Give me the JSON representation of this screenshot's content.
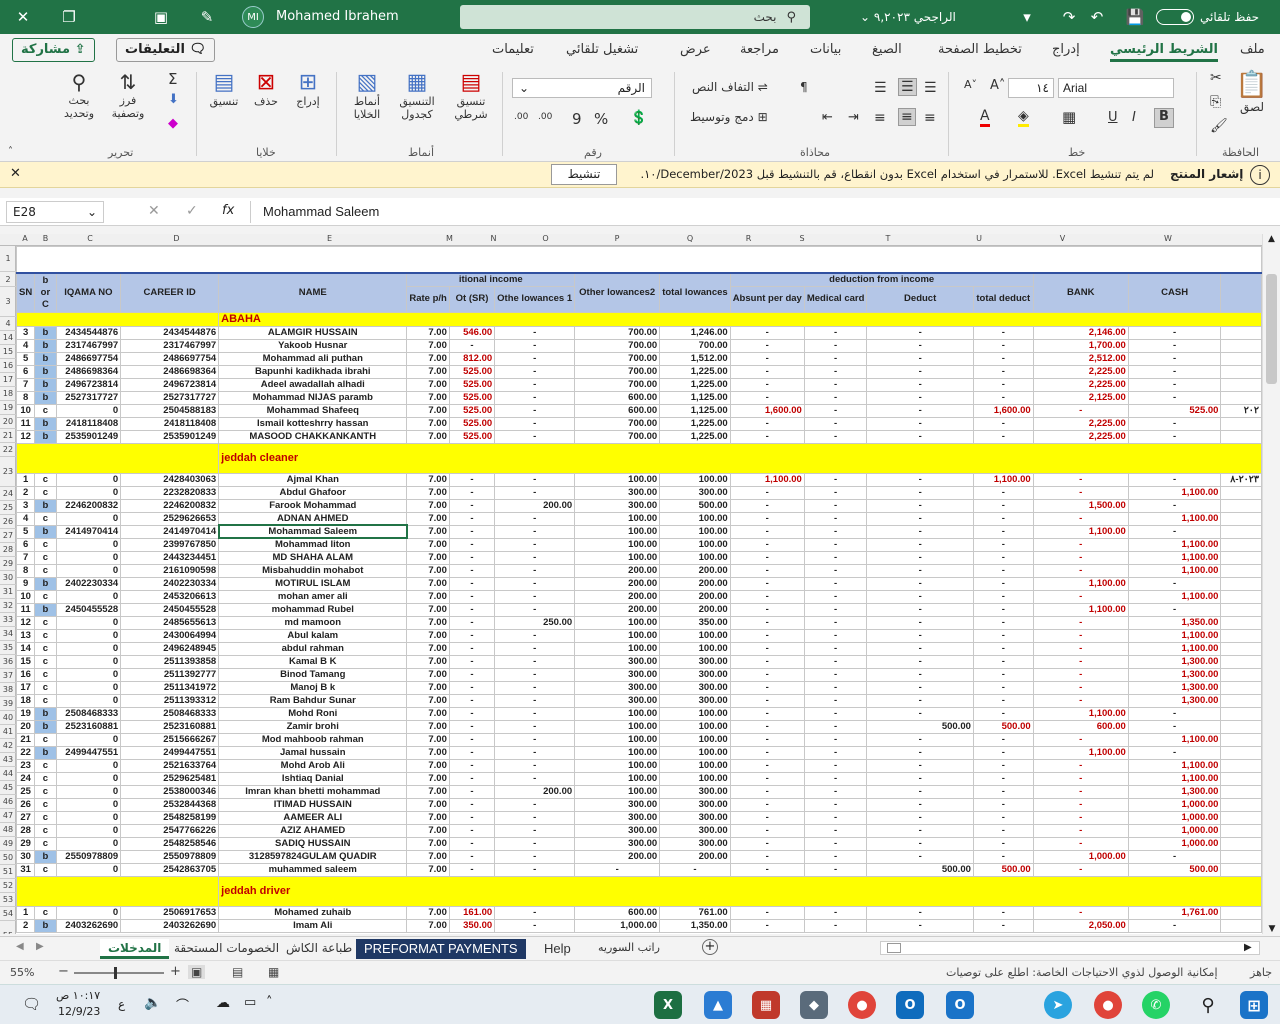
{
  "titlebar": {
    "user_initials": "MI",
    "user": "Mohamed Ibrahem",
    "search": "بحث",
    "file": "الراجحي ٩,٢٠٢٣",
    "autosave": "حفظ تلقائي"
  },
  "tabs": [
    "ملف",
    "الشريط الرئيسي",
    "إدراج",
    "تخطيط الصفحة",
    "الصيغ",
    "بيانات",
    "مراجعة",
    "عرض",
    "تشغيل تلقائي",
    "تعليمات"
  ],
  "share": "مشاركة",
  "comments": "التعليقات",
  "ribbon": {
    "paste": "لصق",
    "font_name": "Arial",
    "font_size": "١٤",
    "wrap": "التفاف النص",
    "merge": "دمج وتوسيط",
    "number_format": "الرقم",
    "cond": "تنسيق شرطي",
    "astable": "التنسيق كجدول",
    "styles": "أنماط الخلايا",
    "insert": "إدراج",
    "delete": "حذف",
    "format": "تنسيق",
    "sort": "فرز وتصفية",
    "find": "بحث وتحديد",
    "g_clip": "الحافظة",
    "g_font": "خط",
    "g_align": "محاذاة",
    "g_num": "رقم",
    "g_styles": "أنماط",
    "g_cells": "خلايا",
    "g_edit": "تحرير"
  },
  "notice": {
    "title": "إشعار المنتج",
    "text": "لم يتم تنشيط Excel. للاستمرار في استخدام Excel بدون انقطاع، قم بالتنشيط قبل December/2023/١٠.",
    "button": "تنشيط"
  },
  "formula": {
    "cellref": "E28",
    "fx": "fx",
    "value": "Mohammad Saleem"
  },
  "columns": [
    "A",
    "B",
    "C",
    "D",
    "E",
    "M",
    "N",
    "O",
    "P",
    "Q",
    "R",
    "S",
    "T",
    "U",
    "V",
    "W"
  ],
  "headers": {
    "sn": "SN",
    "bc": "b or C",
    "iqama": "IQAMA NO",
    "career": "CAREER ID",
    "name": "NAME",
    "addl": "itional income",
    "rate": "Rate p/h",
    "ot": "Ot (SR)",
    "other1": "Othe lowances 1",
    "other2": "Other lowances2",
    "total": "total lowances",
    "deduction": "deduction from income",
    "absent": "Absunt per day",
    "medical": "Medical card",
    "deduct": "Deduct",
    "totdeduct": "total deduct",
    "bank": "BANK",
    "cash": "CASH"
  },
  "sections": [
    {
      "label": "ABAHA",
      "row": "4",
      "rows": [
        [
          "14",
          "3",
          "b",
          "2434544876",
          "2434544876",
          "ALAMGIR HUSSAIN",
          "7.00",
          "546.00",
          "-",
          "700.00",
          "1,246.00",
          "-",
          "-",
          "-",
          "-",
          "2,146.00",
          "-",
          ""
        ],
        [
          "15",
          "4",
          "b",
          "2317467997",
          "2317467997",
          "Yakoob Husnar",
          "7.00",
          "-",
          "-",
          "700.00",
          "700.00",
          "-",
          "-",
          "-",
          "-",
          "1,700.00",
          "-",
          ""
        ],
        [
          "16",
          "5",
          "b",
          "2486697754",
          "2486697754",
          "Mohammad ali puthan",
          "7.00",
          "812.00",
          "-",
          "700.00",
          "1,512.00",
          "-",
          "-",
          "-",
          "-",
          "2,512.00",
          "-",
          ""
        ],
        [
          "17",
          "6",
          "b",
          "2486698364",
          "2486698364",
          "Bapunhi kadikhada ibrahi",
          "7.00",
          "525.00",
          "-",
          "700.00",
          "1,225.00",
          "-",
          "-",
          "-",
          "-",
          "2,225.00",
          "-",
          ""
        ],
        [
          "18",
          "7",
          "b",
          "2496723814",
          "2496723814",
          "Adeel awadallah alhadi",
          "7.00",
          "525.00",
          "-",
          "700.00",
          "1,225.00",
          "-",
          "-",
          "-",
          "-",
          "2,225.00",
          "-",
          ""
        ],
        [
          "19",
          "8",
          "b",
          "2527317727",
          "2527317727",
          "Mohammad NIJAS paramb",
          "7.00",
          "525.00",
          "-",
          "600.00",
          "1,125.00",
          "-",
          "-",
          "-",
          "-",
          "2,125.00",
          "-",
          ""
        ],
        [
          "20",
          "10",
          "c",
          "0",
          "2504588183",
          "Mohammad Shafeeq",
          "7.00",
          "525.00",
          "-",
          "600.00",
          "1,125.00",
          "1,600.00",
          "-",
          "-",
          "1,600.00",
          "-",
          "525.00",
          "٢٠٢"
        ],
        [
          "21",
          "11",
          "b",
          "2418118408",
          "2418118408",
          "Ismail kotteshrry hassan",
          "7.00",
          "525.00",
          "-",
          "700.00",
          "1,225.00",
          "-",
          "-",
          "-",
          "-",
          "2,225.00",
          "-",
          ""
        ],
        [
          "22",
          "12",
          "b",
          "2535901249",
          "2535901249",
          "MASOOD CHAKKANKANTH",
          "7.00",
          "525.00",
          "-",
          "700.00",
          "1,225.00",
          "-",
          "-",
          "-",
          "-",
          "2,225.00",
          "-",
          ""
        ]
      ]
    },
    {
      "label": "jeddah cleaner",
      "row": "23",
      "rows": [
        [
          "24",
          "1",
          "c",
          "0",
          "2428403063",
          "Ajmal Khan",
          "7.00",
          "-",
          "-",
          "100.00",
          "100.00",
          "1,100.00",
          "-",
          "-",
          "1,100.00",
          "-",
          "-",
          "٢٠٢٣-٨"
        ],
        [
          "25",
          "2",
          "c",
          "0",
          "2232820833",
          "Abdul Ghafoor",
          "7.00",
          "-",
          "-",
          "300.00",
          "300.00",
          "-",
          "-",
          "-",
          "-",
          "-",
          "1,100.00",
          ""
        ],
        [
          "26",
          "3",
          "b",
          "2246200832",
          "2246200832",
          "Farook Mohammad",
          "7.00",
          "-",
          "200.00",
          "300.00",
          "500.00",
          "-",
          "-",
          "-",
          "-",
          "1,500.00",
          "-",
          ""
        ],
        [
          "27",
          "4",
          "c",
          "0",
          "2529626653",
          "ADNAN AHMED",
          "7.00",
          "-",
          "-",
          "100.00",
          "100.00",
          "-",
          "-",
          "-",
          "-",
          "-",
          "1,100.00",
          ""
        ],
        [
          "28",
          "5",
          "b",
          "2414970414",
          "2414970414",
          "Mohammad Saleem",
          "7.00",
          "-",
          "-",
          "100.00",
          "100.00",
          "-",
          "-",
          "-",
          "-",
          "1,100.00",
          "-",
          ""
        ],
        [
          "29",
          "6",
          "c",
          "0",
          "2399767850",
          "Mohammad liton",
          "7.00",
          "-",
          "-",
          "100.00",
          "100.00",
          "-",
          "-",
          "-",
          "-",
          "-",
          "1,100.00",
          ""
        ],
        [
          "30",
          "7",
          "c",
          "0",
          "2443234451",
          "MD SHAHA ALAM",
          "7.00",
          "-",
          "-",
          "100.00",
          "100.00",
          "-",
          "-",
          "-",
          "-",
          "-",
          "1,100.00",
          ""
        ],
        [
          "31",
          "8",
          "c",
          "0",
          "2161090598",
          "Misbahuddin mohabot",
          "7.00",
          "-",
          "-",
          "200.00",
          "200.00",
          "-",
          "-",
          "-",
          "-",
          "-",
          "1,100.00",
          ""
        ],
        [
          "32",
          "9",
          "b",
          "2402230334",
          "2402230334",
          "MOTIRUL ISLAM",
          "7.00",
          "-",
          "-",
          "200.00",
          "200.00",
          "-",
          "-",
          "-",
          "-",
          "1,100.00",
          "-",
          ""
        ],
        [
          "33",
          "10",
          "c",
          "0",
          "2453206613",
          "mohan amer ali",
          "7.00",
          "-",
          "-",
          "200.00",
          "200.00",
          "-",
          "-",
          "-",
          "-",
          "-",
          "1,100.00",
          ""
        ],
        [
          "34",
          "11",
          "b",
          "2450455528",
          "2450455528",
          "mohammad Rubel",
          "7.00",
          "-",
          "-",
          "200.00",
          "200.00",
          "-",
          "-",
          "-",
          "-",
          "1,100.00",
          "-",
          ""
        ],
        [
          "35",
          "12",
          "c",
          "0",
          "2485655613",
          "md mamoon",
          "7.00",
          "-",
          "250.00",
          "100.00",
          "350.00",
          "-",
          "-",
          "-",
          "-",
          "-",
          "1,350.00",
          ""
        ],
        [
          "36",
          "13",
          "c",
          "0",
          "2430064994",
          "Abul kalam",
          "7.00",
          "-",
          "-",
          "100.00",
          "100.00",
          "-",
          "-",
          "-",
          "-",
          "-",
          "1,100.00",
          ""
        ],
        [
          "37",
          "14",
          "c",
          "0",
          "2496248945",
          "abdul rahman",
          "7.00",
          "-",
          "-",
          "100.00",
          "100.00",
          "-",
          "-",
          "-",
          "-",
          "-",
          "1,100.00",
          ""
        ],
        [
          "38",
          "15",
          "c",
          "0",
          "2511393858",
          "Kamal B K",
          "7.00",
          "-",
          "-",
          "300.00",
          "300.00",
          "-",
          "-",
          "-",
          "-",
          "-",
          "1,300.00",
          ""
        ],
        [
          "39",
          "16",
          "c",
          "0",
          "2511392777",
          "Binod Tamang",
          "7.00",
          "-",
          "-",
          "300.00",
          "300.00",
          "-",
          "-",
          "-",
          "-",
          "-",
          "1,300.00",
          ""
        ],
        [
          "40",
          "17",
          "c",
          "0",
          "2511341972",
          "Manoj B k",
          "7.00",
          "-",
          "-",
          "300.00",
          "300.00",
          "-",
          "-",
          "-",
          "-",
          "-",
          "1,300.00",
          ""
        ],
        [
          "41",
          "18",
          "c",
          "0",
          "2511393312",
          "Ram Bahdur Sunar",
          "7.00",
          "-",
          "-",
          "300.00",
          "300.00",
          "-",
          "-",
          "-",
          "-",
          "-",
          "1,300.00",
          ""
        ],
        [
          "42",
          "19",
          "b",
          "2508468333",
          "2508468333",
          "Mohd Roni",
          "7.00",
          "-",
          "-",
          "100.00",
          "100.00",
          "-",
          "-",
          "-",
          "-",
          "1,100.00",
          "-",
          ""
        ],
        [
          "43",
          "20",
          "b",
          "2523160881",
          "2523160881",
          "Zamir brohi",
          "7.00",
          "-",
          "-",
          "100.00",
          "100.00",
          "-",
          "-",
          "500.00",
          "500.00",
          "600.00",
          "-",
          ""
        ],
        [
          "44",
          "21",
          "c",
          "0",
          "2515666267",
          "Mod mahboob rahman",
          "7.00",
          "-",
          "-",
          "100.00",
          "100.00",
          "-",
          "-",
          "-",
          "-",
          "-",
          "1,100.00",
          ""
        ],
        [
          "45",
          "22",
          "b",
          "2499447551",
          "2499447551",
          "Jamal hussain",
          "7.00",
          "-",
          "-",
          "100.00",
          "100.00",
          "-",
          "-",
          "-",
          "-",
          "1,100.00",
          "-",
          ""
        ],
        [
          "46",
          "23",
          "c",
          "0",
          "2521633764",
          "Mohd Arob Ali",
          "7.00",
          "-",
          "-",
          "100.00",
          "100.00",
          "-",
          "-",
          "-",
          "-",
          "-",
          "1,100.00",
          ""
        ],
        [
          "47",
          "24",
          "c",
          "0",
          "2529625481",
          "Ishtiaq Danial",
          "7.00",
          "-",
          "-",
          "100.00",
          "100.00",
          "-",
          "-",
          "-",
          "-",
          "-",
          "1,100.00",
          ""
        ],
        [
          "48",
          "25",
          "c",
          "0",
          "2538000346",
          "Imran khan bhetti mohammad",
          "7.00",
          "-",
          "200.00",
          "100.00",
          "300.00",
          "-",
          "-",
          "-",
          "-",
          "-",
          "1,300.00",
          ""
        ],
        [
          "49",
          "26",
          "c",
          "0",
          "2532844368",
          "ITIMAD HUSSAIN",
          "7.00",
          "-",
          "-",
          "300.00",
          "300.00",
          "-",
          "-",
          "-",
          "-",
          "-",
          "1,000.00",
          ""
        ],
        [
          "50",
          "27",
          "c",
          "0",
          "2548258199",
          "AAMEER ALI",
          "7.00",
          "-",
          "-",
          "300.00",
          "300.00",
          "-",
          "-",
          "-",
          "-",
          "-",
          "1,000.00",
          ""
        ],
        [
          "51",
          "28",
          "c",
          "0",
          "2547766226",
          "AZIZ AHAMED",
          "7.00",
          "-",
          "-",
          "300.00",
          "300.00",
          "-",
          "-",
          "-",
          "-",
          "-",
          "1,000.00",
          ""
        ],
        [
          "52",
          "29",
          "c",
          "0",
          "2548258546",
          "SADIQ HUSSAIN",
          "7.00",
          "-",
          "-",
          "300.00",
          "300.00",
          "-",
          "-",
          "-",
          "-",
          "-",
          "1,000.00",
          ""
        ],
        [
          "53",
          "30",
          "b",
          "2550978809",
          "2550978809",
          "3128597824GULAM QUADIR",
          "7.00",
          "-",
          "-",
          "200.00",
          "200.00",
          "-",
          "-",
          "-",
          "-",
          "1,000.00",
          "-",
          ""
        ],
        [
          "54",
          "31",
          "c",
          "0",
          "2542863705",
          "muhammed saleem",
          "7.00",
          "-",
          "-",
          "-",
          "-",
          "-",
          "-",
          "500.00",
          "500.00",
          "-",
          "500.00",
          ""
        ]
      ]
    },
    {
      "label": "jeddah driver",
      "row": "55",
      "rows": [
        [
          "56",
          "1",
          "c",
          "0",
          "2506917653",
          "Mohamed zuhaib",
          "7.00",
          "161.00",
          "-",
          "600.00",
          "761.00",
          "-",
          "-",
          "-",
          "-",
          "-",
          "1,761.00",
          ""
        ],
        [
          "57",
          "2",
          "b",
          "2403262690",
          "2403262690",
          "Imam Ali",
          "7.00",
          "350.00",
          "-",
          "1,000.00",
          "1,350.00",
          "-",
          "-",
          "-",
          "-",
          "2,050.00",
          "-",
          ""
        ]
      ]
    }
  ],
  "sheettabs": [
    "المدخلات",
    "الخصومات المستحقة",
    "طباعة الكاش",
    "PREFORMAT PAYMENTS",
    "Help",
    "راتب السوريه"
  ],
  "status": {
    "ready": "جاهز",
    "access": "إمكانية الوصول لذوي الاحتياجات الخاصة: اطلع على توصيات",
    "zoom": "55%"
  },
  "taskbar": {
    "time": "١٠:١٧ ص",
    "date": "12/9/23",
    "lang": "ع"
  }
}
